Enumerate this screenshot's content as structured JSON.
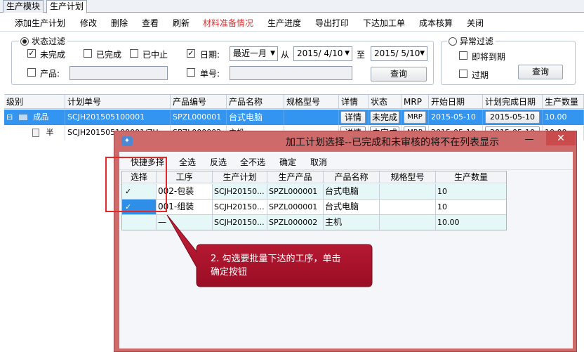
{
  "module_tabs": [
    "生产模块",
    "生产计划"
  ],
  "menu": {
    "items": [
      "添加生产计划",
      "修改",
      "删除",
      "查看",
      "刷新",
      "材料准备情况",
      "生产进度",
      "导出打印",
      "下达加工单",
      "成本核算",
      "关闭"
    ],
    "highlight_color": "#e03030"
  },
  "status_filter": {
    "title": "状态过滤",
    "unfinished": "未完成",
    "finished": "已完成",
    "stopped": "已中止",
    "product_label": "产品:",
    "date_label": "日期:",
    "date_range_option": "最近一月",
    "from_label": "从",
    "date_from": "2015/ 4/10",
    "to_label": "至",
    "date_to": "2015/ 5/10",
    "order_label": "单号:",
    "query": "查询"
  },
  "abnormal_filter": {
    "title": "异常过滤",
    "due_soon": "即将到期",
    "overdue": "过期",
    "query": "查询"
  },
  "main_grid": {
    "headers": [
      "级别",
      "计划单号",
      "产品编号",
      "产品名称",
      "规格型号",
      "详情",
      "状态",
      "MRP",
      "开始日期",
      "计划完成日期",
      "生产数量"
    ],
    "rows": [
      {
        "expander": "⊟",
        "level": "成品",
        "plan_no": "SCJH201505100001",
        "product_no": "SPZL000001",
        "product_name": "台式电脑",
        "spec": "",
        "detail": "详情",
        "status": "未完成",
        "mrp": "MRP",
        "start_date": "2015-05-10",
        "finish_date": "2015-05-10",
        "qty": "10.00"
      },
      {
        "expander": "",
        "level": "半",
        "plan_no": "SCJH201505100001/ZH",
        "product_no": "SPZL000002",
        "product_name": "主机",
        "spec": "",
        "detail": "详情",
        "status": "未完成",
        "mrp": "MRP",
        "start_date": "2015-05-10",
        "finish_date": "2015-05-10",
        "qty": "10.00"
      }
    ]
  },
  "dialog": {
    "title": "加工计划选择--已完成和未审核的将不在列表显示",
    "minimize": "—",
    "close": "✕",
    "toolbar": [
      "快捷多择",
      "全选",
      "反选",
      "全不选",
      "确定",
      "取消"
    ],
    "headers": [
      "选择",
      "工序",
      "生产计划",
      "生产产品",
      "产品名称",
      "规格型号",
      "生产数量"
    ],
    "rows": [
      {
        "check": "✓",
        "process": "002-包装",
        "plan": "SCJH20150...",
        "product": "SPZL000001",
        "name": "台式电脑",
        "spec": "",
        "qty": "10"
      },
      {
        "check": "✓",
        "process": "001-组装",
        "plan": "SCJH20150...",
        "product": "SPZL000001",
        "name": "台式电脑",
        "spec": "",
        "qty": "10"
      },
      {
        "check": "",
        "process": "—",
        "plan": "SCJH20150...",
        "product": "SPZL000002",
        "name": "主机",
        "spec": "",
        "qty": "10.00"
      }
    ]
  },
  "callout": {
    "text_line1": "2. 勾选要批量下达的工序，单击",
    "text_line2": "确定按钮",
    "color": "#b3102b"
  }
}
